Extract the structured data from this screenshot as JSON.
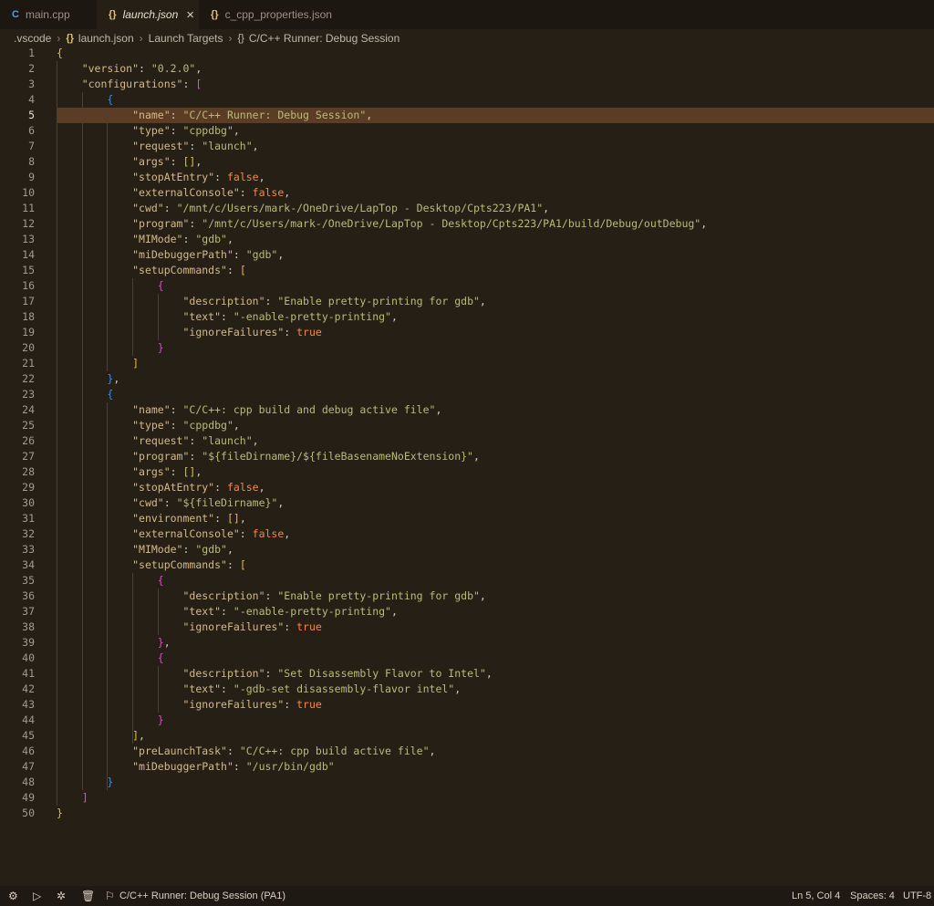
{
  "tabs": [
    {
      "icon": "C",
      "label": "main.cpp",
      "active": false
    },
    {
      "icon": "{}",
      "label": "launch.json",
      "active": true
    },
    {
      "icon": "{}",
      "label": "c_cpp_properties.json",
      "active": false
    }
  ],
  "breadcrumb": {
    "folder": ".vscode",
    "file": "launch.json",
    "section": "Launch Targets",
    "symbol": "C/C++ Runner: Debug Session"
  },
  "editor": {
    "current_line": 5,
    "lines": [
      [
        [
          "b0",
          "{"
        ]
      ],
      [
        [
          "punc",
          "    "
        ],
        [
          "key",
          "\"version\""
        ],
        [
          "punc",
          ": "
        ],
        [
          "str",
          "\"0.2.0\""
        ],
        [
          "punc",
          ","
        ]
      ],
      [
        [
          "punc",
          "    "
        ],
        [
          "key",
          "\"configurations\""
        ],
        [
          "punc",
          ": "
        ],
        [
          "b1",
          "["
        ]
      ],
      [
        [
          "punc",
          "        "
        ],
        [
          "b2",
          "{"
        ]
      ],
      [
        [
          "punc",
          "            "
        ],
        [
          "key",
          "\"name\""
        ],
        [
          "punc",
          ": "
        ],
        [
          "str",
          "\"C/C++ Runner: Debug Session\""
        ],
        [
          "punc",
          ","
        ]
      ],
      [
        [
          "punc",
          "            "
        ],
        [
          "key",
          "\"type\""
        ],
        [
          "punc",
          ": "
        ],
        [
          "str",
          "\"cppdbg\""
        ],
        [
          "punc",
          ","
        ]
      ],
      [
        [
          "punc",
          "            "
        ],
        [
          "key",
          "\"request\""
        ],
        [
          "punc",
          ": "
        ],
        [
          "str",
          "\"launch\""
        ],
        [
          "punc",
          ","
        ]
      ],
      [
        [
          "punc",
          "            "
        ],
        [
          "key",
          "\"args\""
        ],
        [
          "punc",
          ": "
        ],
        [
          "b0",
          "[]"
        ],
        [
          "punc",
          ","
        ]
      ],
      [
        [
          "punc",
          "            "
        ],
        [
          "key",
          "\"stopAtEntry\""
        ],
        [
          "punc",
          ": "
        ],
        [
          "lit",
          "false"
        ],
        [
          "punc",
          ","
        ]
      ],
      [
        [
          "punc",
          "            "
        ],
        [
          "key",
          "\"externalConsole\""
        ],
        [
          "punc",
          ": "
        ],
        [
          "lit",
          "false"
        ],
        [
          "punc",
          ","
        ]
      ],
      [
        [
          "punc",
          "            "
        ],
        [
          "key",
          "\"cwd\""
        ],
        [
          "punc",
          ": "
        ],
        [
          "str",
          "\"/mnt/c/Users/mark-/OneDrive/LapTop - Desktop/Cpts223/PA1\""
        ],
        [
          "punc",
          ","
        ]
      ],
      [
        [
          "punc",
          "            "
        ],
        [
          "key",
          "\"program\""
        ],
        [
          "punc",
          ": "
        ],
        [
          "str",
          "\"/mnt/c/Users/mark-/OneDrive/LapTop - Desktop/Cpts223/PA1/build/Debug/outDebug\""
        ],
        [
          "punc",
          ","
        ]
      ],
      [
        [
          "punc",
          "            "
        ],
        [
          "key",
          "\"MIMode\""
        ],
        [
          "punc",
          ": "
        ],
        [
          "str",
          "\"gdb\""
        ],
        [
          "punc",
          ","
        ]
      ],
      [
        [
          "punc",
          "            "
        ],
        [
          "key",
          "\"miDebuggerPath\""
        ],
        [
          "punc",
          ": "
        ],
        [
          "str",
          "\"gdb\""
        ],
        [
          "punc",
          ","
        ]
      ],
      [
        [
          "punc",
          "            "
        ],
        [
          "key",
          "\"setupCommands\""
        ],
        [
          "punc",
          ": "
        ],
        [
          "b0",
          "["
        ]
      ],
      [
        [
          "punc",
          "                "
        ],
        [
          "b1",
          "{"
        ]
      ],
      [
        [
          "punc",
          "                    "
        ],
        [
          "key",
          "\"description\""
        ],
        [
          "punc",
          ": "
        ],
        [
          "str",
          "\"Enable pretty-printing for gdb\""
        ],
        [
          "punc",
          ","
        ]
      ],
      [
        [
          "punc",
          "                    "
        ],
        [
          "key",
          "\"text\""
        ],
        [
          "punc",
          ": "
        ],
        [
          "str",
          "\"-enable-pretty-printing\""
        ],
        [
          "punc",
          ","
        ]
      ],
      [
        [
          "punc",
          "                    "
        ],
        [
          "key",
          "\"ignoreFailures\""
        ],
        [
          "punc",
          ": "
        ],
        [
          "lit",
          "true"
        ]
      ],
      [
        [
          "punc",
          "                "
        ],
        [
          "b1",
          "}"
        ]
      ],
      [
        [
          "punc",
          "            "
        ],
        [
          "b0",
          "]"
        ]
      ],
      [
        [
          "punc",
          "        "
        ],
        [
          "b2",
          "}"
        ],
        [
          "punc",
          ","
        ]
      ],
      [
        [
          "punc",
          "        "
        ],
        [
          "b2",
          "{"
        ]
      ],
      [
        [
          "punc",
          "            "
        ],
        [
          "key",
          "\"name\""
        ],
        [
          "punc",
          ": "
        ],
        [
          "str",
          "\"C/C++: cpp build and debug active file\""
        ],
        [
          "punc",
          ","
        ]
      ],
      [
        [
          "punc",
          "            "
        ],
        [
          "key",
          "\"type\""
        ],
        [
          "punc",
          ": "
        ],
        [
          "str",
          "\"cppdbg\""
        ],
        [
          "punc",
          ","
        ]
      ],
      [
        [
          "punc",
          "            "
        ],
        [
          "key",
          "\"request\""
        ],
        [
          "punc",
          ": "
        ],
        [
          "str",
          "\"launch\""
        ],
        [
          "punc",
          ","
        ]
      ],
      [
        [
          "punc",
          "            "
        ],
        [
          "key",
          "\"program\""
        ],
        [
          "punc",
          ": "
        ],
        [
          "str",
          "\"${fileDirname}/${fileBasenameNoExtension}\""
        ],
        [
          "punc",
          ","
        ]
      ],
      [
        [
          "punc",
          "            "
        ],
        [
          "key",
          "\"args\""
        ],
        [
          "punc",
          ": "
        ],
        [
          "b0",
          "[]"
        ],
        [
          "punc",
          ","
        ]
      ],
      [
        [
          "punc",
          "            "
        ],
        [
          "key",
          "\"stopAtEntry\""
        ],
        [
          "punc",
          ": "
        ],
        [
          "lit",
          "false"
        ],
        [
          "punc",
          ","
        ]
      ],
      [
        [
          "punc",
          "            "
        ],
        [
          "key",
          "\"cwd\""
        ],
        [
          "punc",
          ": "
        ],
        [
          "str",
          "\"${fileDirname}\""
        ],
        [
          "punc",
          ","
        ]
      ],
      [
        [
          "punc",
          "            "
        ],
        [
          "key",
          "\"environment\""
        ],
        [
          "punc",
          ": "
        ],
        [
          "b0",
          "[]"
        ],
        [
          "punc",
          ","
        ]
      ],
      [
        [
          "punc",
          "            "
        ],
        [
          "key",
          "\"externalConsole\""
        ],
        [
          "punc",
          ": "
        ],
        [
          "lit",
          "false"
        ],
        [
          "punc",
          ","
        ]
      ],
      [
        [
          "punc",
          "            "
        ],
        [
          "key",
          "\"MIMode\""
        ],
        [
          "punc",
          ": "
        ],
        [
          "str",
          "\"gdb\""
        ],
        [
          "punc",
          ","
        ]
      ],
      [
        [
          "punc",
          "            "
        ],
        [
          "key",
          "\"setupCommands\""
        ],
        [
          "punc",
          ": "
        ],
        [
          "b0",
          "["
        ]
      ],
      [
        [
          "punc",
          "                "
        ],
        [
          "b1",
          "{"
        ]
      ],
      [
        [
          "punc",
          "                    "
        ],
        [
          "key",
          "\"description\""
        ],
        [
          "punc",
          ": "
        ],
        [
          "str",
          "\"Enable pretty-printing for gdb\""
        ],
        [
          "punc",
          ","
        ]
      ],
      [
        [
          "punc",
          "                    "
        ],
        [
          "key",
          "\"text\""
        ],
        [
          "punc",
          ": "
        ],
        [
          "str",
          "\"-enable-pretty-printing\""
        ],
        [
          "punc",
          ","
        ]
      ],
      [
        [
          "punc",
          "                    "
        ],
        [
          "key",
          "\"ignoreFailures\""
        ],
        [
          "punc",
          ": "
        ],
        [
          "lit",
          "true"
        ]
      ],
      [
        [
          "punc",
          "                "
        ],
        [
          "b1",
          "}"
        ],
        [
          "punc",
          ","
        ]
      ],
      [
        [
          "punc",
          "                "
        ],
        [
          "b1",
          "{"
        ]
      ],
      [
        [
          "punc",
          "                    "
        ],
        [
          "key",
          "\"description\""
        ],
        [
          "punc",
          ": "
        ],
        [
          "str",
          "\"Set Disassembly Flavor to Intel\""
        ],
        [
          "punc",
          ","
        ]
      ],
      [
        [
          "punc",
          "                    "
        ],
        [
          "key",
          "\"text\""
        ],
        [
          "punc",
          ": "
        ],
        [
          "str",
          "\"-gdb-set disassembly-flavor intel\""
        ],
        [
          "punc",
          ","
        ]
      ],
      [
        [
          "punc",
          "                    "
        ],
        [
          "key",
          "\"ignoreFailures\""
        ],
        [
          "punc",
          ": "
        ],
        [
          "lit",
          "true"
        ]
      ],
      [
        [
          "punc",
          "                "
        ],
        [
          "b1",
          "}"
        ]
      ],
      [
        [
          "punc",
          "            "
        ],
        [
          "b0",
          "]"
        ],
        [
          "punc",
          ","
        ]
      ],
      [
        [
          "punc",
          "            "
        ],
        [
          "key",
          "\"preLaunchTask\""
        ],
        [
          "punc",
          ": "
        ],
        [
          "str",
          "\"C/C++: cpp build active file\""
        ],
        [
          "punc",
          ","
        ]
      ],
      [
        [
          "punc",
          "            "
        ],
        [
          "key",
          "\"miDebuggerPath\""
        ],
        [
          "punc",
          ": "
        ],
        [
          "str",
          "\"/usr/bin/gdb\""
        ]
      ],
      [
        [
          "punc",
          "        "
        ],
        [
          "b2",
          "}"
        ]
      ],
      [
        [
          "punc",
          "    "
        ],
        [
          "b1",
          "]"
        ]
      ],
      [
        [
          "b0",
          "}"
        ]
      ]
    ]
  },
  "statusbar": {
    "launch_config": "C/C++ Runner: Debug Session (PA1)",
    "position": "Ln 5, Col 4",
    "spaces": "Spaces: 4",
    "encoding": "UTF-8"
  },
  "colors": {
    "background": "#251f16",
    "highlight_line": "#5a3d24",
    "key": "#d6b98a",
    "string": "#b8bc7a",
    "literal": "#f18a4b"
  }
}
